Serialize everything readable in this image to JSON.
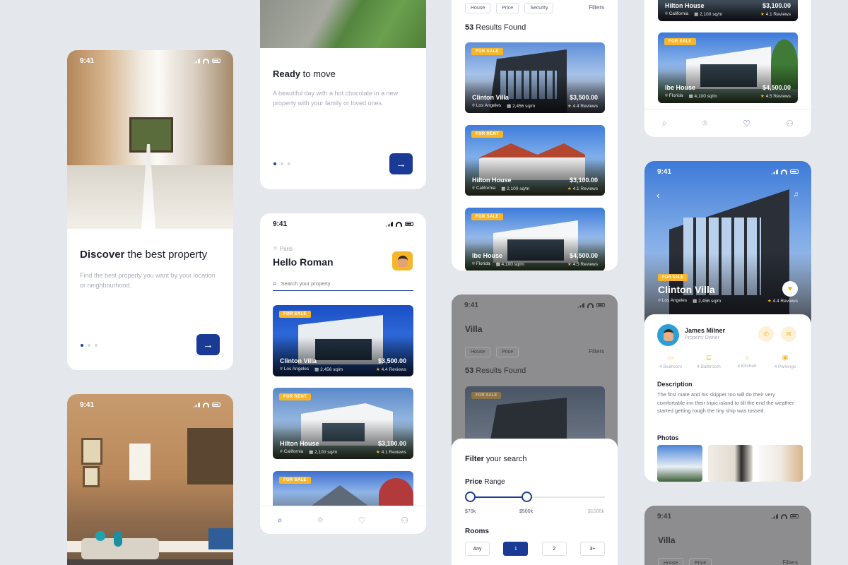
{
  "status_time": "9:41",
  "onboard1": {
    "title_bold": "Discover",
    "title_rest": " the best property",
    "desc": "Find the best property you want by your location or neighbourhood."
  },
  "onboard2": {
    "title_bold": "Ready",
    "title_rest": " to move",
    "desc": "A beautiful day with a hot chocolate in a new property with your family or loved ones."
  },
  "home": {
    "location": "Paris",
    "greeting": "Hello Roman",
    "search_placeholder": "Search your property"
  },
  "filters": {
    "chips": [
      "House",
      "Price",
      "Security"
    ],
    "filters_label": "Filters",
    "results_count": "53",
    "results_label": " Results Found"
  },
  "properties": [
    {
      "tag": "FOR SALE",
      "name": "Clinton Villa",
      "price": "$3,500.00",
      "location": "Los Angeles",
      "area": "2,456 sq/m",
      "reviews": "4.4 Reviews"
    },
    {
      "tag": "FOR RENT",
      "name": "Hilton House",
      "price": "$3,100.00",
      "location": "California",
      "area": "2,100 sq/m",
      "reviews": "4.1 Reviews"
    },
    {
      "tag": "FOR SALE",
      "name": "Ibe House",
      "price": "$4,500.00",
      "location": "Florida",
      "area": "4,100 sq/m",
      "reviews": "4.5 Reviews"
    }
  ],
  "villa": {
    "title": "Villa",
    "chips": [
      "House",
      "Price"
    ],
    "filters_label": "Filters",
    "results_count": "53",
    "results_label": " Results Found",
    "tag": "FOR SALE"
  },
  "filter_sheet": {
    "title_bold": "Filter",
    "title_rest": " your search",
    "price_bold": "Price",
    "price_rest": " Range",
    "price_min": "$70k",
    "price_sel": "$500k",
    "price_max": "$1000k",
    "rooms_label": "Rooms",
    "rooms": [
      "Any",
      "1",
      "2",
      "3+"
    ]
  },
  "detail": {
    "tag": "FOR SALE",
    "name": "Clinton Villa",
    "location": "Los Angeles",
    "area": "2,456 sq/m",
    "reviews": "4.4 Reviews",
    "owner_name": "James Milner",
    "owner_role": "Property Owner",
    "amenities": [
      "4 Bedroom",
      "4 Bathroom",
      "4 Kitchen",
      "4 Parkings"
    ],
    "desc_title": "Description",
    "desc": "The first mate and his skipper too will do their very comfortable inn their tripic island to till the end the weather started getting rough the tiny ship was tossed.",
    "photos_title": "Photos"
  },
  "bottom_villa": {
    "title": "Villa",
    "chips": [
      "House",
      "Price"
    ],
    "filters_label": "Filters"
  },
  "colors": {
    "primary": "#1a3a96",
    "accent": "#f7b52a",
    "background": "#e4e7ec"
  }
}
